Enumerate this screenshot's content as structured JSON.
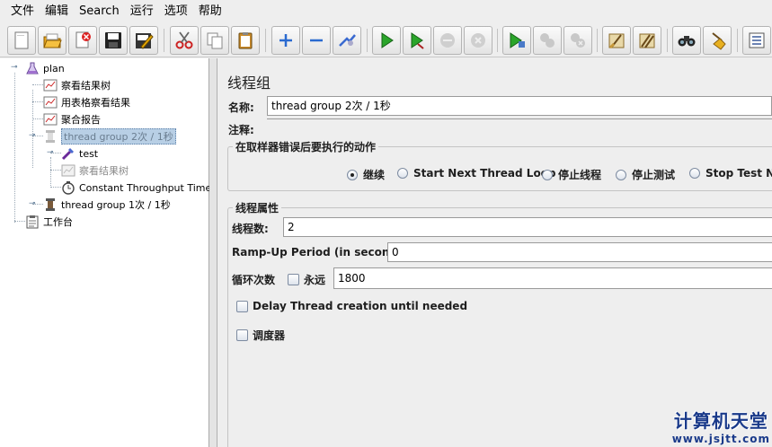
{
  "menubar": {
    "items": [
      "文件",
      "编辑",
      "Search",
      "运行",
      "选项",
      "帮助"
    ]
  },
  "toolbar": {
    "buttons": [
      "new-icon",
      "open-icon",
      "close-icon",
      "save-icon",
      "save-as-icon",
      "cut-icon",
      "copy-icon",
      "paste-icon",
      "expand-icon",
      "collapse-icon",
      "toggle-icon",
      "start-icon",
      "start-no-pause-icon",
      "stop-icon",
      "shutdown-icon",
      "remote-start-icon",
      "remote-stop-icon",
      "remote-shutdown-icon",
      "clear-icon",
      "clear-all-icon",
      "search-icon",
      "reset-search-icon",
      "function-helper-icon"
    ]
  },
  "tree": {
    "plan": "plan",
    "results_tree": "察看结果树",
    "table_results": "用表格察看结果",
    "aggregate_report": "聚合报告",
    "thread_group_selected": "thread group 2次 / 1秒",
    "sampler_test": "test",
    "disabled_results_tree": "察看结果树",
    "timer": "Constant Throughput Timer",
    "thread_group_2": "thread group 1次 / 1秒",
    "workbench": "工作台"
  },
  "panel": {
    "title": "线程组",
    "name_label": "名称:",
    "name_value": "thread group 2次 / 1秒",
    "comment_label": "注释:",
    "comment_value": "",
    "error_action": {
      "title": "在取样器错误后要执行的动作",
      "options": [
        "继续",
        "Start Next Thread Loop",
        "停止线程",
        "停止测试",
        "Stop Test Now"
      ],
      "selected": "继续"
    },
    "thread_props": {
      "title": "线程属性",
      "threads_label": "线程数:",
      "threads_value": "2",
      "rampup_label": "Ramp-Up Period (in seconds):",
      "rampup_value": "0",
      "loop_label": "循环次数",
      "forever_label": "永远",
      "forever_checked": false,
      "loop_value": "1800",
      "delay_label": "Delay Thread creation until needed",
      "delay_checked": false,
      "scheduler_label": "调度器",
      "scheduler_checked": false
    }
  },
  "watermark": {
    "line1": "计算机天堂",
    "line2": "www.jsjtt.com"
  }
}
